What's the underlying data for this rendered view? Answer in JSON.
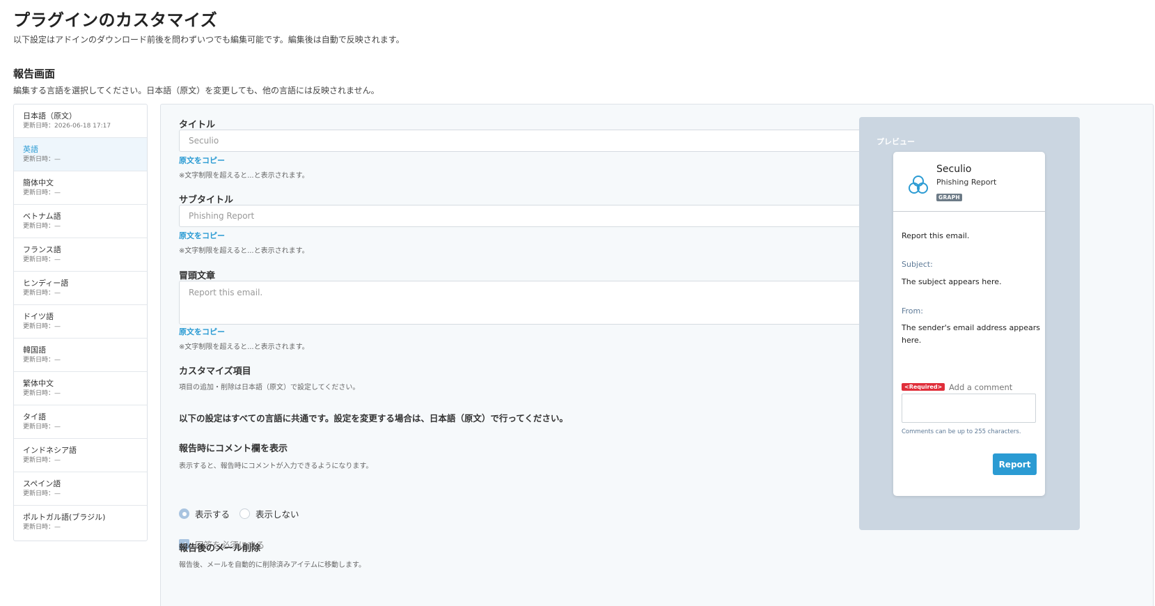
{
  "page": {
    "title": "プラグインのカスタマイズ",
    "subtitle": "以下設定はアドインのダウンロード前後を問わずいつでも編集可能です。編集後は自動で反映されます。"
  },
  "section": {
    "title": "報告画面",
    "description": "編集する言語を選択してください。日本語（原文）を変更しても、他の言語には反映されません。"
  },
  "languages": [
    {
      "name": "日本語（原文）",
      "updated": "更新日時：2026-06-18 17:17",
      "active": false
    },
    {
      "name": "英語",
      "updated": "更新日時：—",
      "active": true
    },
    {
      "name": "簡体中文",
      "updated": "更新日時：—",
      "active": false
    },
    {
      "name": "ベトナム語",
      "updated": "更新日時：—",
      "active": false
    },
    {
      "name": "フランス語",
      "updated": "更新日時：—",
      "active": false
    },
    {
      "name": "ヒンディー語",
      "updated": "更新日時：—",
      "active": false
    },
    {
      "name": "ドイツ語",
      "updated": "更新日時：—",
      "active": false
    },
    {
      "name": "韓国語",
      "updated": "更新日時：—",
      "active": false
    },
    {
      "name": "繁体中文",
      "updated": "更新日時：—",
      "active": false
    },
    {
      "name": "タイ語",
      "updated": "更新日時：—",
      "active": false
    },
    {
      "name": "インドネシア語",
      "updated": "更新日時：—",
      "active": false
    },
    {
      "name": "スペイン語",
      "updated": "更新日時：—",
      "active": false
    },
    {
      "name": "ポルトガル語(ブラジル)",
      "updated": "更新日時：—",
      "active": false
    }
  ],
  "form": {
    "title_label": "タイトル",
    "title_placeholder": "Seculio",
    "subtitle_label": "サブタイトル",
    "subtitle_placeholder": "Phishing Report",
    "intro_label": "冒頭文章",
    "intro_placeholder": "Report this email.",
    "copy_link": "原文をコピー",
    "limit_hint": "※文字制限を超えると...と表示されます。",
    "custom_items_label": "カスタマイズ項目",
    "custom_items_hint": "項目の追加・削除は日本語（原文）で設定してください。",
    "common_note": "以下の設定はすべての言語に共通です。設定を変更する場合は、日本語（原文）で行ってください。",
    "comment_field_label": "報告時にコメント欄を表示",
    "comment_field_hint": "表示すると、報告時にコメントが入力できるようになります。",
    "radio_show": "表示する",
    "radio_hide": "表示しない",
    "radio_selected": "show",
    "required_checkbox": "回答を必須にする",
    "required_checked": true,
    "delete_label": "報告後のメール削除",
    "delete_hint": "報告後、メールを自動的に削除済みアイテムに移動します。"
  },
  "preview": {
    "label": "プレビュー",
    "app_name": "Seculio",
    "app_subtitle": "Phishing Report",
    "badge": "GRAPH",
    "intro": "Report this email.",
    "subject_label": "Subject:",
    "subject_text": "The subject appears here.",
    "from_label": "From:",
    "from_text": "The sender's email address appears here.",
    "required_badge": "<Required>",
    "comment_label": "Add a comment",
    "comment_hint": "Comments can be up to 255 characters.",
    "report_button": "Report"
  },
  "colors": {
    "accent": "#2b9bd3",
    "required": "#e02e3a",
    "preview_bg": "#cbd6e1",
    "label_blue": "#5d7996"
  }
}
